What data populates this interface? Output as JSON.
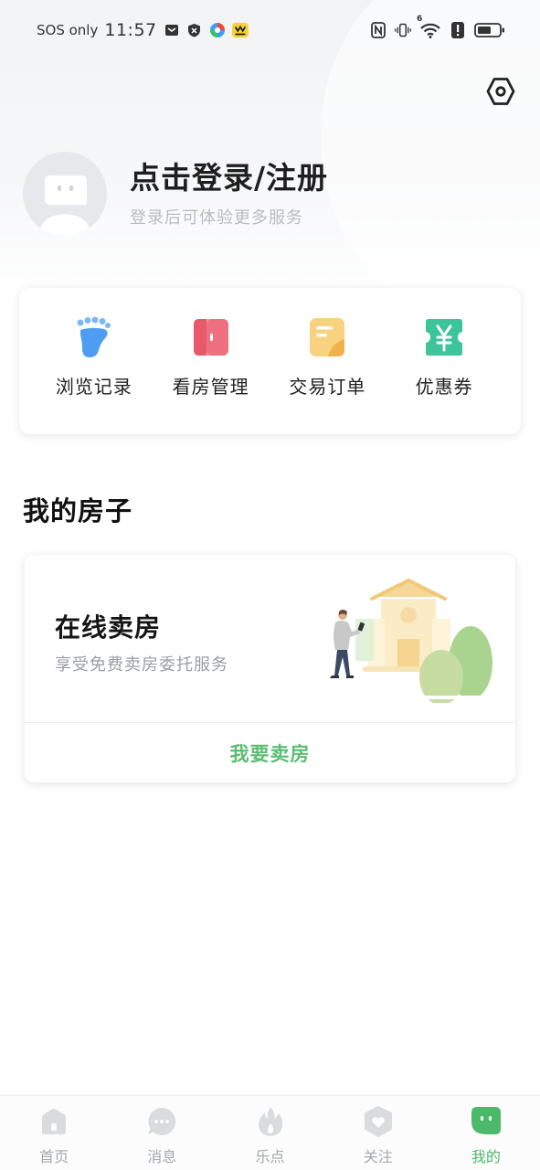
{
  "status_bar": {
    "sos_text": "SOS only",
    "time": "11:57",
    "network_badge": "6"
  },
  "profile": {
    "login_title": "点击登录/注册",
    "login_subtitle": "登录后可体验更多服务"
  },
  "quick_entries": [
    {
      "label": "浏览记录",
      "icon": "footprint-icon",
      "color": "#4f9df2"
    },
    {
      "label": "看房管理",
      "icon": "door-icon",
      "color": "#ee6a7b"
    },
    {
      "label": "交易订单",
      "icon": "order-icon",
      "color": "#f6c15a"
    },
    {
      "label": "优惠券",
      "icon": "coupon-icon",
      "color": "#3dc59a"
    }
  ],
  "my_house": {
    "section_title": "我的房子",
    "sell_title": "在线卖房",
    "sell_desc": "享受免费卖房委托服务",
    "sell_button": "我要卖房"
  },
  "tabs": [
    {
      "label": "首页",
      "icon": "home-icon",
      "active": false
    },
    {
      "label": "消息",
      "icon": "message-icon",
      "active": false
    },
    {
      "label": "乐点",
      "icon": "flame-icon",
      "active": false
    },
    {
      "label": "关注",
      "icon": "heart-shield-icon",
      "active": false
    },
    {
      "label": "我的",
      "icon": "profile-face-icon",
      "active": true
    }
  ],
  "colors": {
    "accent_green": "#4cb96a",
    "tab_inactive": "#a5a8ab",
    "sell_button_text": "#5bbd72"
  }
}
